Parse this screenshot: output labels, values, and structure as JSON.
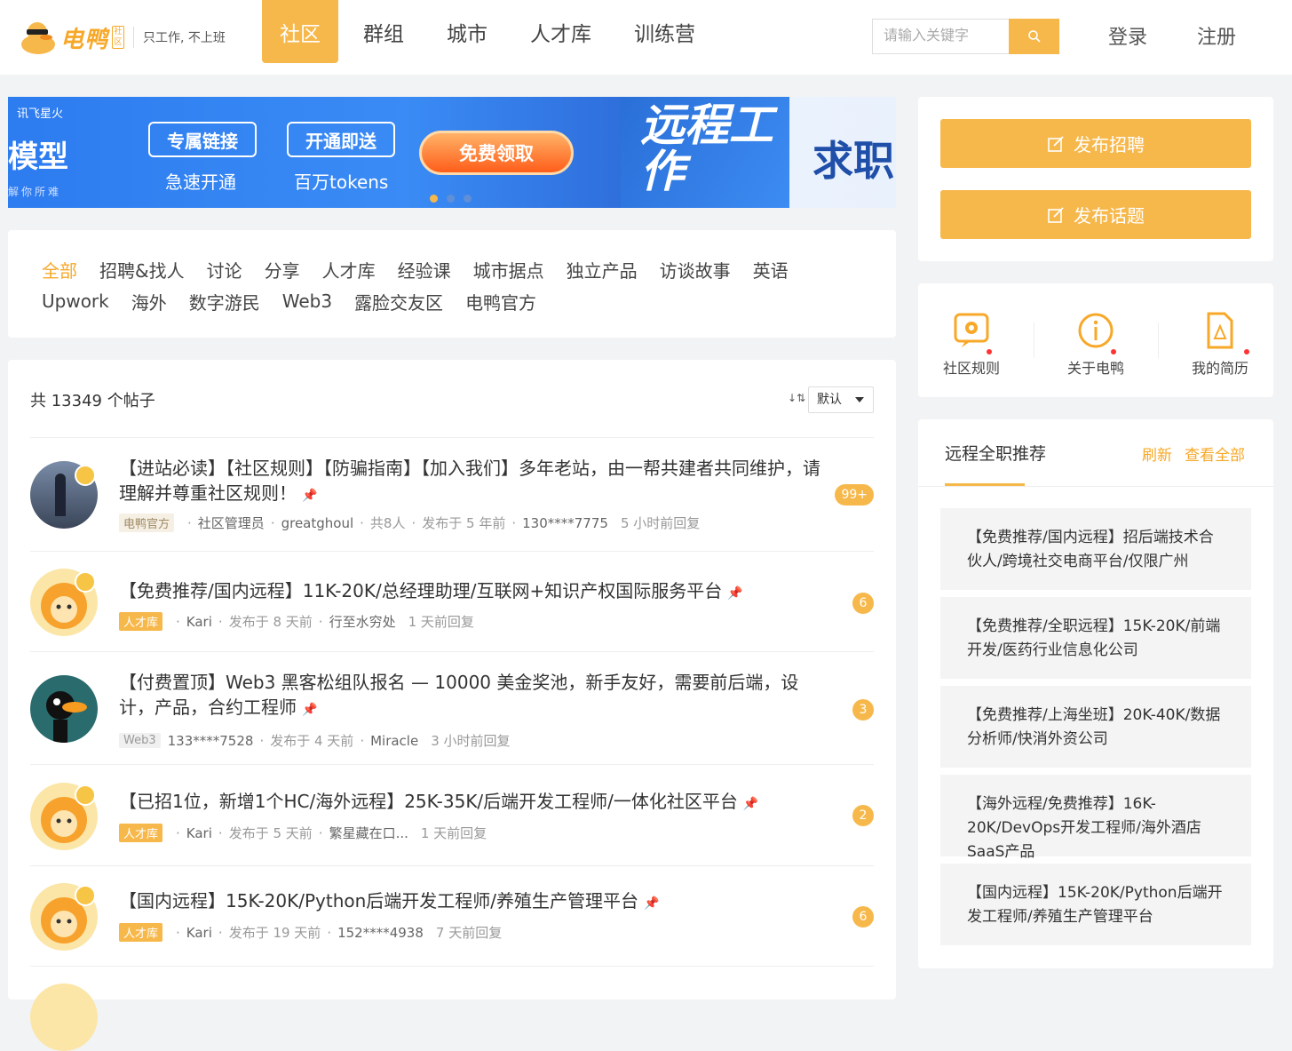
{
  "header": {
    "logo_text": "电鸭",
    "logo_badge": "社区",
    "slogan": "只工作, 不上班",
    "nav": [
      {
        "label": "社区",
        "active": true
      },
      {
        "label": "群组",
        "active": false
      },
      {
        "label": "城市",
        "active": false
      },
      {
        "label": "人才库",
        "active": false
      },
      {
        "label": "训练营",
        "active": false
      }
    ],
    "search_placeholder": "请输入关键字",
    "login": "登录",
    "register": "注册",
    "accent": "#f7b84b"
  },
  "banner": {
    "brand": "讯飞星火",
    "left_big": "模型",
    "left_small": "解你所难",
    "box1": "专属链接",
    "box1_sub": "急速开通",
    "box2": "开通即送",
    "box2_sub": "百万tokens",
    "cta": "免费领取",
    "remote": "远程工作",
    "job": "求职"
  },
  "categories": {
    "row1": [
      "全部",
      "招聘&找人",
      "讨论",
      "分享",
      "人才库",
      "经验课",
      "城市据点",
      "独立产品",
      "访谈故事",
      "英语"
    ],
    "row2": [
      "Upwork",
      "海外",
      "数字游民",
      "Web3",
      "露脸交友区",
      "电鸭官方"
    ]
  },
  "posts": {
    "total_label": "共 13349 个帖子",
    "sort_value": "默认",
    "sort_icon_label": "↓⇅",
    "items": [
      {
        "title": "【进站必读】【社区规则】【防骗指南】【加入我们】多年老站，由一帮共建者共同维护，请理解并尊重社区规则！",
        "tag": "电鸭官方",
        "author": "社区管理员",
        "extra": "greatghoul",
        "members": "共8人",
        "posted": "发布于 5 年前",
        "replier": "130****7775",
        "replied": "5 小时前回复",
        "count": "99+"
      },
      {
        "title": "【免费推荐/国内远程】11K-20K/总经理助理/互联网+知识产权国际服务平台",
        "tag": "人才库",
        "author": "Kari",
        "posted": "发布于 8 天前",
        "replier": "行至水穷处",
        "replied": "1 天前回复",
        "count": "6"
      },
      {
        "title": "【付费置顶】Web3 黑客松组队报名 — 10000 美金奖池，新手友好，需要前后端，设计，产品，合约工程师",
        "tag": "Web3",
        "author": "133****7528",
        "posted": "发布于 4 天前",
        "replier": "Miracle",
        "replied": "3 小时前回复",
        "count": "3"
      },
      {
        "title": "【已招1位，新增1个HC/海外远程】25K-35K/后端开发工程师/一体化社区平台",
        "tag": "人才库",
        "author": "Kari",
        "posted": "发布于 5 天前",
        "replier": "繁星藏在口...",
        "replied": "1 天前回复",
        "count": "2"
      },
      {
        "title": "【国内远程】15K-20K/Python后端开发工程师/养殖生产管理平台",
        "tag": "人才库",
        "author": "Kari",
        "posted": "发布于 19 天前",
        "replier": "152****4938",
        "replied": "7 天前回复",
        "count": "6"
      }
    ]
  },
  "sidebar": {
    "post_job": "发布招聘",
    "post_topic": "发布话题",
    "links": [
      "社区规则",
      "关于电鸭",
      "我的简历"
    ],
    "recs_title": "远程全职推荐",
    "recs_refresh": "刷新",
    "recs_all": "查看全部",
    "recs": [
      "【免费推荐/国内远程】招后端技术合伙人/跨境社交电商平台/仅限广州",
      "【免费推荐/全职远程】15K-20K/前端开发/医药行业信息化公司",
      "【免费推荐/上海坐班】20K-40K/数据分析师/快消外资公司",
      "【海外远程/免费推荐】16K-20K/DevOps开发工程师/海外酒店SaaS产品",
      "【国内远程】15K-20K/Python后端开发工程师/养殖生产管理平台"
    ]
  }
}
